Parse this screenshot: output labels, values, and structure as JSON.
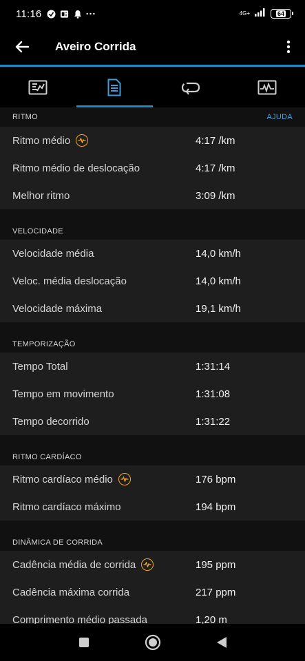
{
  "status_bar": {
    "time": "11:16",
    "network": "4G+",
    "battery": "64"
  },
  "app_bar": {
    "title": "Aveiro Corrida"
  },
  "tabs": [
    {
      "icon": "chart-card-icon",
      "active": false
    },
    {
      "icon": "document-list-icon",
      "active": true
    },
    {
      "icon": "laps-loop-icon",
      "active": false
    },
    {
      "icon": "graph-pulse-icon",
      "active": false
    }
  ],
  "sections": {
    "pace": {
      "title": "RITMO",
      "help": "AJUDA",
      "rows": [
        {
          "label": "Ritmo médio",
          "value": "4:17 /km",
          "icon": "heart-rate-badge-icon"
        },
        {
          "label": "Ritmo médio de deslocação",
          "value": "4:17 /km"
        },
        {
          "label": "Melhor ritmo",
          "value": "3:09 /km"
        }
      ]
    },
    "speed": {
      "title": "VELOCIDADE",
      "rows": [
        {
          "label": "Velocidade média",
          "value": "14,0 km/h"
        },
        {
          "label": "Veloc. média deslocação",
          "value": "14,0 km/h"
        },
        {
          "label": "Velocidade máxima",
          "value": "19,1 km/h"
        }
      ]
    },
    "timing": {
      "title": "TEMPORIZAÇÃO",
      "rows": [
        {
          "label": "Tempo Total",
          "value": "1:31:14"
        },
        {
          "label": "Tempo em movimento",
          "value": "1:31:08"
        },
        {
          "label": "Tempo decorrido",
          "value": "1:31:22"
        }
      ]
    },
    "heart": {
      "title": "RITMO CARDÍACO",
      "rows": [
        {
          "label": "Ritmo cardíaco médio",
          "value": "176 bpm",
          "icon": "heart-rate-badge-icon"
        },
        {
          "label": "Ritmo cardíaco máximo",
          "value": "194 bpm"
        }
      ]
    },
    "dynamics": {
      "title": "DINÂMICA DE CORRIDA",
      "rows": [
        {
          "label": "Cadência média de corrida",
          "value": "195 ppm",
          "icon": "heart-rate-badge-icon"
        },
        {
          "label": "Cadência máxima corrida",
          "value": "217 ppm"
        },
        {
          "label": "Comprimento médio passada",
          "value": "1,20 m"
        }
      ]
    }
  },
  "colors": {
    "accent": "#1e88c7",
    "help_link": "#4aa3df",
    "badge": "#f5a623"
  }
}
